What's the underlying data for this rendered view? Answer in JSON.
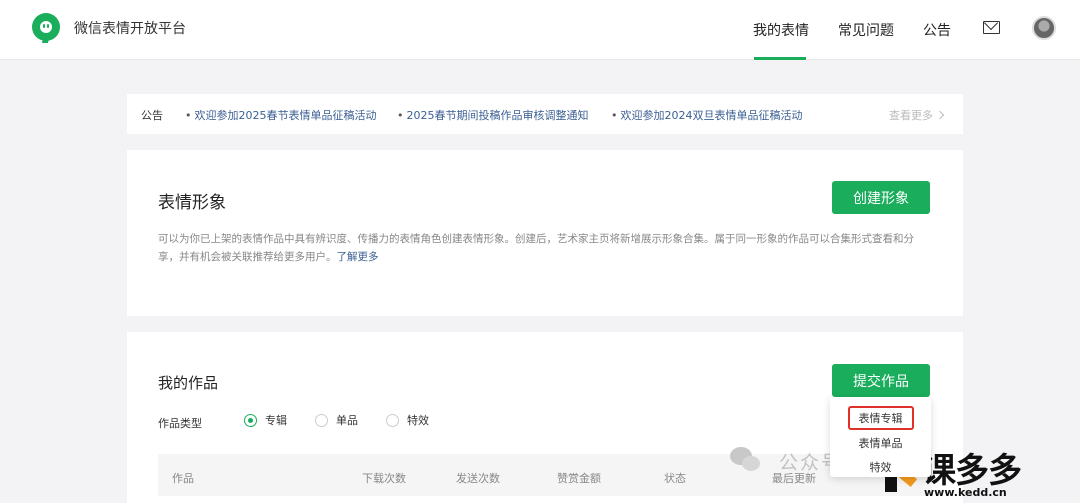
{
  "header": {
    "brand": "微信表情开放平台",
    "nav": {
      "mine": "我的表情",
      "faq": "常见问题",
      "notice": "公告"
    }
  },
  "notice_bar": {
    "label": "公告",
    "items": [
      "欢迎参加2025春节表情单品征稿活动",
      "2025春节期间投稿作品审核调整通知",
      "欢迎参加2024双旦表情单品征稿活动"
    ],
    "more": "查看更多"
  },
  "persona_card": {
    "title": "表情形象",
    "create_button": "创建形象",
    "description": "可以为你已上架的表情作品中具有辨识度、传播力的表情角色创建表情形象。创建后，艺术家主页将新增展示形象合集。属于同一形象的作品可以合集形式查看和分享，并有机会被关联推荐给更多用户。",
    "learn_more": "了解更多"
  },
  "works_card": {
    "title": "我的作品",
    "submit_button": "提交作品",
    "type_label": "作品类型",
    "types": [
      "专辑",
      "单品",
      "特效"
    ],
    "table_headers": [
      "作品",
      "下载次数",
      "发送次数",
      "赞赏金额",
      "状态",
      "最后更新"
    ]
  },
  "submit_dropdown": {
    "items": [
      "表情专辑",
      "表情单品",
      "特效"
    ]
  },
  "watermark": {
    "wechat_text": "公众号",
    "brand": "课多多",
    "url": "www.kedd.cn"
  },
  "colors": {
    "accent": "#1aad5c",
    "link": "#3b5f93",
    "highlight_border": "#e0302a"
  }
}
